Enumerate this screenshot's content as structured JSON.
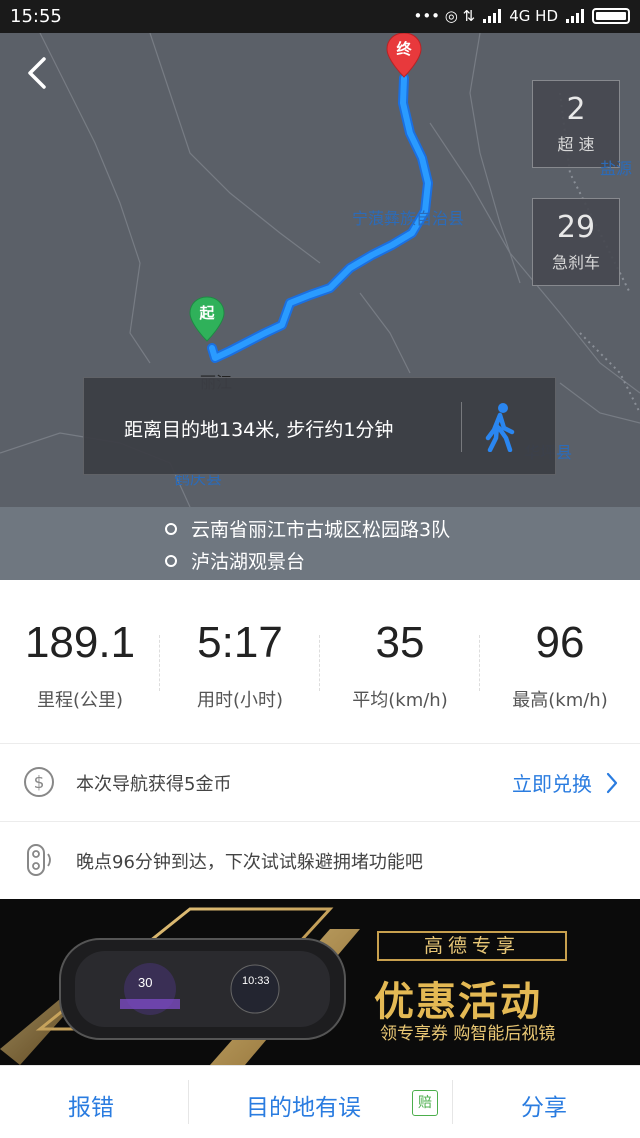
{
  "status_bar": {
    "time": "15:55",
    "indicators": "••• ◎ ⇅",
    "network": "4G HD"
  },
  "map": {
    "back_icon": "chevron-left-icon",
    "speeding": {
      "value": "2",
      "label": "超 速"
    },
    "hard_brake": {
      "value": "29",
      "label": "急刹车"
    },
    "labels": {
      "county": "宁蒗彝族自治县",
      "lijiang": "丽江",
      "heqing": "鹤庆县",
      "huaping": "华坪县",
      "yanyuan": "盐源"
    },
    "start_pin": "起",
    "end_pin": "终",
    "walk_message": "距离目的地134米, 步行约1分钟",
    "route_color": "#1e88ff"
  },
  "route": {
    "origin": "云南省丽江市古城区松园路3队",
    "destination": "泸沽湖观景台"
  },
  "stats": [
    {
      "value": "189.1",
      "label": "里程(公里)"
    },
    {
      "value": "5:17",
      "label": "用时(小时)"
    },
    {
      "value": "35",
      "label": "平均(km/h)"
    },
    {
      "value": "96",
      "label": "最高(km/h)"
    }
  ],
  "coins": {
    "text": "本次导航获得5金币",
    "action": "立即兑换"
  },
  "traffic_tip": {
    "text": "晚点96分钟到达，下次试试躲避拥堵功能吧"
  },
  "ad": {
    "tag": "高德专享",
    "headline": "优惠活动",
    "subline": "领专享券 购智能后视镜",
    "speed_readout": "30",
    "clock_readout": "10:33"
  },
  "bottom_bar": {
    "report": "报错",
    "wrong_destination": "目的地有误",
    "badge": "赔",
    "share": "分享"
  }
}
